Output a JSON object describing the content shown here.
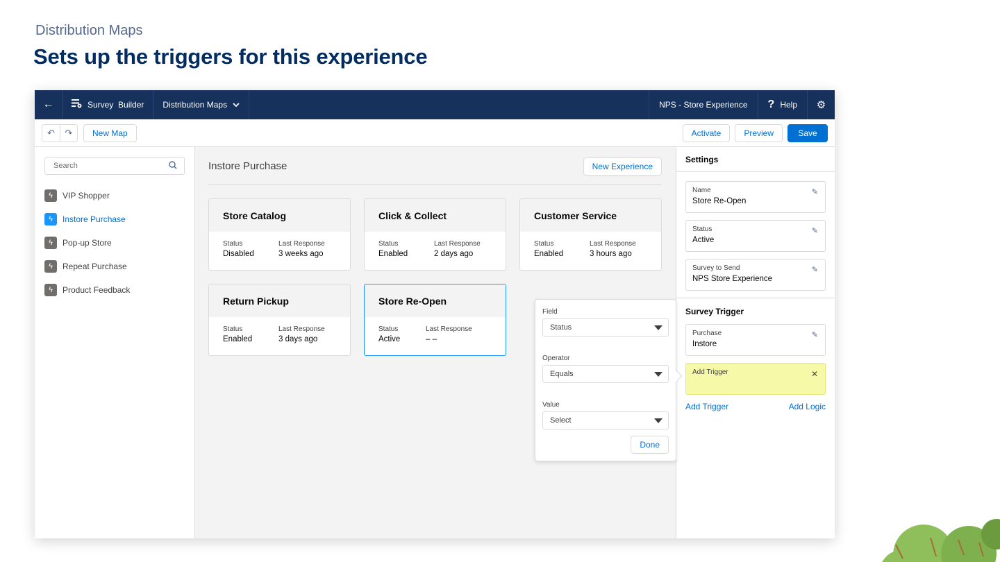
{
  "slide": {
    "eyebrow": "Distribution Maps",
    "title": "Sets up the triggers for this experience"
  },
  "topbar": {
    "back_icon": "back-arrow-icon",
    "app_name": "Survey  Builder",
    "menu_label": "Distribution Maps",
    "experience_name": "NPS - Store Experience",
    "help_label": "Help",
    "help_glyph": "?"
  },
  "toolbar": {
    "undo_glyph": "↶",
    "redo_glyph": "↷",
    "new_map_label": "New Map",
    "activate_label": "Activate",
    "preview_label": "Preview",
    "save_label": "Save"
  },
  "sidebar": {
    "search_placeholder": "Search",
    "items": [
      {
        "label": "VIP Shopper"
      },
      {
        "label": "Instore Purchase"
      },
      {
        "label": "Pop-up Store"
      },
      {
        "label": "Repeat Purchase"
      },
      {
        "label": "Product Feedback"
      }
    ]
  },
  "canvas": {
    "title": "Instore Purchase",
    "new_experience_label": "New Experience",
    "cards": [
      {
        "title": "Store Catalog",
        "status_label": "Status",
        "status": "Disabled",
        "response_label": "Last Response",
        "response": "3 weeks ago"
      },
      {
        "title": "Click & Collect",
        "status_label": "Status",
        "status": "Enabled",
        "response_label": "Last Response",
        "response": "2 days ago"
      },
      {
        "title": "Customer Service",
        "status_label": "Status",
        "status": "Enabled",
        "response_label": "Last Response",
        "response": "3 hours ago"
      },
      {
        "title": "Return Pickup",
        "status_label": "Status",
        "status": "Enabled",
        "response_label": "Last Response",
        "response": "3 days ago"
      },
      {
        "title": "Store Re-Open",
        "status_label": "Status",
        "status": "Active",
        "response_label": "Last Response",
        "response": "– –"
      }
    ]
  },
  "popover": {
    "field_label": "Field",
    "field_value": "Status",
    "operator_label": "Operator",
    "operator_value": "Equals",
    "value_label": "Value",
    "value_value": "Select",
    "done_label": "Done"
  },
  "settings": {
    "title": "Settings",
    "fields": [
      {
        "label": "Name",
        "value": "Store Re-Open"
      },
      {
        "label": "Status",
        "value": "Active"
      },
      {
        "label": "Survey to Send",
        "value": "NPS Store Experience"
      }
    ],
    "trigger_title": "Survey Trigger",
    "trigger_field": {
      "label": "Purchase",
      "value": "Instore"
    },
    "add_trigger_box_label": "Add Trigger",
    "add_trigger_link": "Add Trigger",
    "add_logic_link": "Add Logic"
  },
  "colors": {
    "topbar": "#16325c",
    "brand": "#0070d2",
    "highlight": "#f6f9a8",
    "title": "#032d60"
  }
}
